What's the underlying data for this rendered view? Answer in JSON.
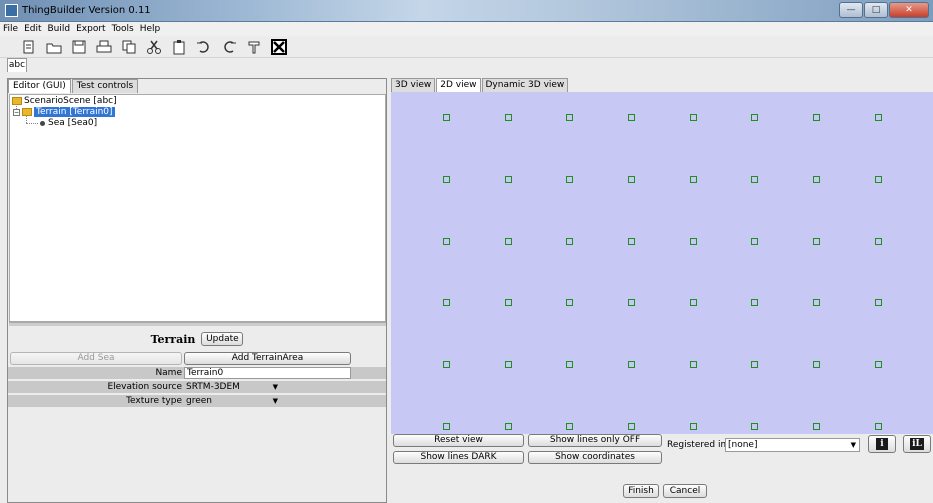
{
  "window": {
    "title": "ThingBuilder Version 0.11"
  },
  "menu": [
    "File",
    "Edit",
    "Build",
    "Export",
    "Tools",
    "Help"
  ],
  "toolbar_icons": [
    "new-file-icon",
    "open-folder-icon",
    "save-icon",
    "print-icon",
    "copy-icon",
    "cut-icon",
    "paste-icon",
    "undo-icon",
    "redo-icon",
    "build-icon",
    "close-x-icon"
  ],
  "file_tab": "abc",
  "left": {
    "tabs": [
      "Editor (GUI)",
      "Test controls"
    ],
    "tree": {
      "root": "ScenarioScene [abc]",
      "child": "Terrain [Terrain0]",
      "leaf": "Sea [Sea0]"
    },
    "props": {
      "title": "Terrain",
      "update_label": "Update",
      "add_sea_label": "Add Sea",
      "add_area_label": "Add TerrainArea",
      "name_label": "Name",
      "name_value": "Terrain0",
      "elevation_label": "Elevation source",
      "elevation_value": "SRTM-3DEM",
      "texture_label": "Texture type",
      "texture_value": "green"
    }
  },
  "right": {
    "tabs": [
      "3D view",
      "2D view",
      "Dynamic 3D view"
    ],
    "grid": {
      "columns": 8,
      "rows": 6
    },
    "colors": {
      "canvas": "#c8c8f5",
      "point": "#1f8f1f"
    },
    "controls": {
      "reset_view": "Reset view",
      "show_lines_only": "Show lines only OFF",
      "show_lines_dark": "Show lines DARK",
      "show_coordinates": "Show coordinates",
      "registered_image_label": "Registered image",
      "registered_image_value": "[none]",
      "finish": "Finish",
      "cancel": "Cancel"
    }
  }
}
